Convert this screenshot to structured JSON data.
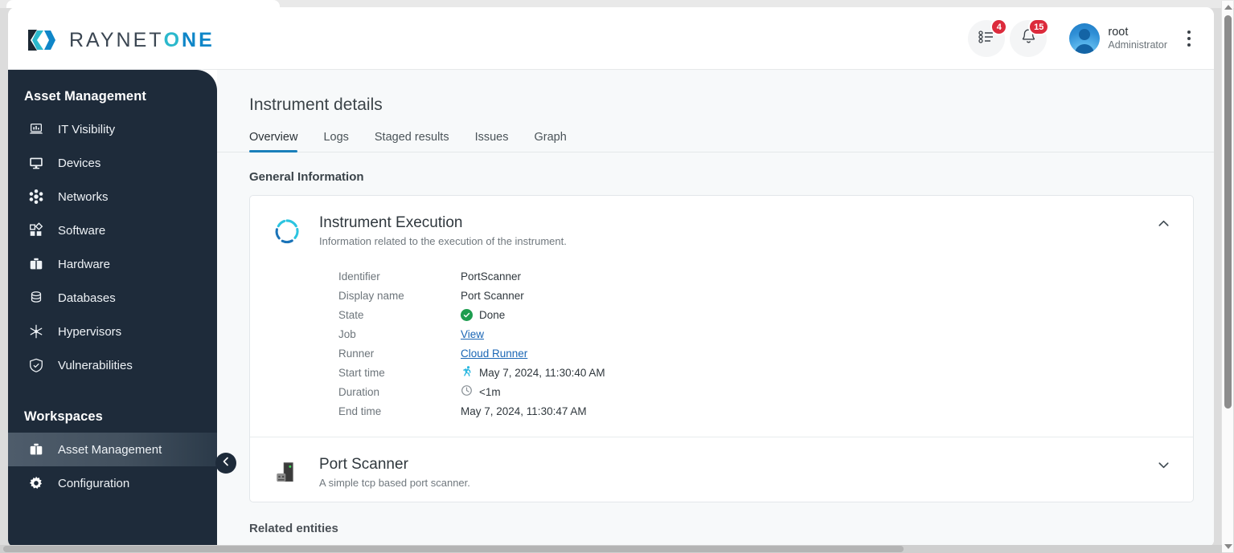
{
  "brand": {
    "name_part1": "RAYNET",
    "name_part2": "O",
    "name_part3": "NE",
    "color_teal": "#2bb8cc",
    "color_blue": "#0f86c8",
    "logo_icon": "raynet-logo-icon"
  },
  "topbar": {
    "tasks": {
      "icon": "task-list-icon",
      "badge": "4"
    },
    "notifications": {
      "icon": "bell-icon",
      "badge": "15"
    },
    "user": {
      "name": "root",
      "role": "Administrator",
      "avatar_icon": "user-avatar-icon"
    },
    "overflow_icon": "kebab-menu-icon"
  },
  "sidebar": {
    "group1_title": "Asset Management",
    "group2_title": "Workspaces",
    "collapse_icon": "chevron-left-icon",
    "items": [
      {
        "label": "IT Visibility",
        "icon": "laptop-chart-icon",
        "active": false
      },
      {
        "label": "Devices",
        "icon": "monitor-icon",
        "active": false
      },
      {
        "label": "Networks",
        "icon": "network-nodes-icon",
        "active": false
      },
      {
        "label": "Software",
        "icon": "app-grid-icon",
        "active": false
      },
      {
        "label": "Hardware",
        "icon": "briefcase-icon",
        "active": false
      },
      {
        "label": "Databases",
        "icon": "database-icon",
        "active": false
      },
      {
        "label": "Hypervisors",
        "icon": "snowflake-icon",
        "active": false
      },
      {
        "label": "Vulnerabilities",
        "icon": "shield-check-icon",
        "active": false
      }
    ],
    "workspaces": [
      {
        "label": "Asset Management",
        "icon": "briefcase-icon",
        "active": true
      },
      {
        "label": "Configuration",
        "icon": "gear-icon",
        "active": false
      }
    ]
  },
  "main": {
    "page_title": "Instrument details",
    "tabs": [
      {
        "label": "Overview",
        "active": true
      },
      {
        "label": "Logs",
        "active": false
      },
      {
        "label": "Staged results",
        "active": false
      },
      {
        "label": "Issues",
        "active": false
      },
      {
        "label": "Graph",
        "active": false
      }
    ],
    "section_title": "General Information",
    "related_title": "Related entities",
    "cards": [
      {
        "title": "Instrument Execution",
        "subtitle": "Information related to the execution of the instrument.",
        "icon": "execution-spinner-icon",
        "chevron": "chevron-up-icon",
        "expanded": true,
        "rows": [
          {
            "key": "Identifier",
            "value": "PortScanner",
            "icon": "",
            "link": false
          },
          {
            "key": "Display name",
            "value": "Port Scanner",
            "icon": "",
            "link": false
          },
          {
            "key": "State",
            "value": "Done",
            "icon": "check-circle-icon",
            "link": false
          },
          {
            "key": "Job",
            "value": "View",
            "icon": "",
            "link": true
          },
          {
            "key": "Runner",
            "value": "Cloud Runner",
            "icon": "",
            "link": true
          },
          {
            "key": "Start time",
            "value": "May 7, 2024, 11:30:40 AM",
            "icon": "runner-icon",
            "link": false
          },
          {
            "key": "Duration",
            "value": "<1m",
            "icon": "clock-icon",
            "link": false
          },
          {
            "key": "End time",
            "value": "May 7, 2024, 11:30:47 AM",
            "icon": "",
            "link": false
          }
        ]
      },
      {
        "title": "Port Scanner",
        "subtitle": "A simple tcp based port scanner.",
        "icon": "port-scanner-icon",
        "chevron": "chevron-down-icon",
        "expanded": false,
        "rows": []
      }
    ]
  },
  "colors": {
    "accent_blue": "#1a7fba",
    "link_blue": "#1a66b5",
    "sidebar_bg": "#1e2b3a",
    "badge_red": "#dc2b3c",
    "success_green": "#1d9d4f"
  }
}
